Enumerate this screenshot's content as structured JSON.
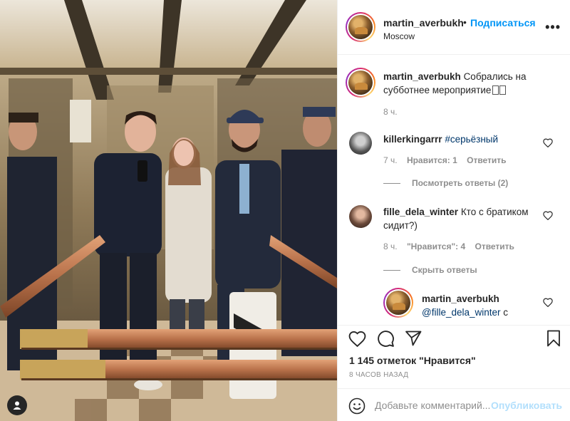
{
  "post": {
    "author": "martin_averbukh",
    "follow_label": "Подписаться",
    "dot": "•",
    "location": "Moscow",
    "more_label": "•••",
    "caption": {
      "author": "martin_averbukh",
      "text": "Собрались на субботнее мероприятие",
      "time": "8 ч."
    },
    "comments": [
      {
        "author": "killerkingarrr",
        "hashtag": "#серьёзный",
        "time": "7 ч.",
        "likes": "Нравится: 1",
        "reply": "Ответить",
        "toggle": "Посмотреть ответы (2)"
      },
      {
        "author": "fille_dela_winter",
        "text_line1": "Кто с братиком",
        "text_line2": "сидит?)",
        "time": "8 ч.",
        "likes": "\"Нравится\": 4",
        "reply": "Ответить",
        "toggle": "Скрыть ответы"
      }
    ],
    "reply": {
      "author": "martin_averbukh",
      "mention": "@fille_dela_winter",
      "text_tail": " с"
    },
    "likes_count": "1 145 отметок \"Нравится\"",
    "time_ago": "8 ЧАСОВ НАЗАД",
    "add_comment_placeholder": "Добавьте комментарий...",
    "publish_label": "Опубликовать"
  },
  "colors": {
    "link_blue": "#0095f6",
    "publish_disabled": "#b2dffc",
    "secondary_text": "#8e8e8e",
    "primary_text": "#262626",
    "hashtag": "#00376b"
  },
  "icons": [
    "more-options-icon",
    "heart-icon",
    "comment-icon",
    "share-icon",
    "bookmark-icon",
    "emoji-icon",
    "user-tag-icon"
  ]
}
